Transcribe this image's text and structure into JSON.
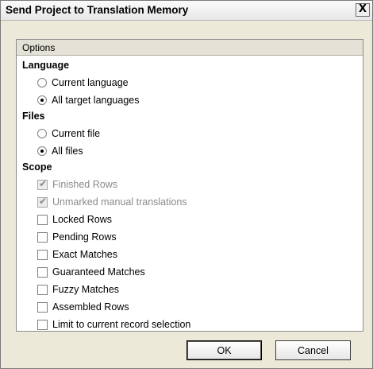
{
  "window": {
    "title": "Send Project to Translation Memory",
    "close_glyph": "X"
  },
  "options": {
    "header": "Options",
    "language": {
      "heading": "Language",
      "current": "Current language",
      "all": "All target languages",
      "selected": "all"
    },
    "files": {
      "heading": "Files",
      "current": "Current file",
      "all": "All files",
      "selected": "all"
    },
    "scope": {
      "heading": "Scope",
      "items": [
        {
          "label": "Finished Rows",
          "checked": true,
          "disabled": true
        },
        {
          "label": "Unmarked manual translations",
          "checked": true,
          "disabled": true
        },
        {
          "label": "Locked Rows",
          "checked": false,
          "disabled": false
        },
        {
          "label": "Pending Rows",
          "checked": false,
          "disabled": false
        },
        {
          "label": "Exact Matches",
          "checked": false,
          "disabled": false
        },
        {
          "label": "Guaranteed Matches",
          "checked": false,
          "disabled": false
        },
        {
          "label": "Fuzzy Matches",
          "checked": false,
          "disabled": false
        },
        {
          "label": "Assembled Rows",
          "checked": false,
          "disabled": false
        },
        {
          "label": "Limit to current record selection",
          "checked": false,
          "disabled": false
        }
      ]
    }
  },
  "buttons": {
    "ok": "OK",
    "cancel": "Cancel"
  }
}
